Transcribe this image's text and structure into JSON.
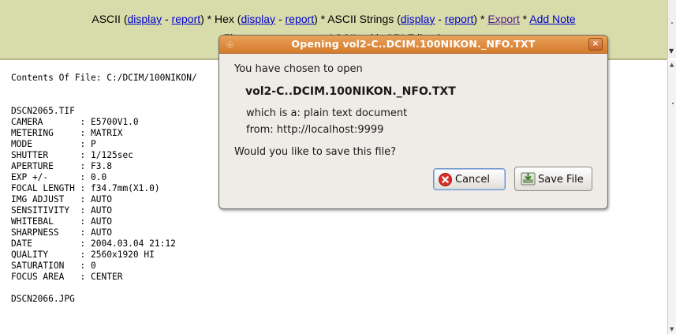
{
  "toolbar": {
    "line1": {
      "ascii_label": "ASCII (",
      "display1": "display",
      "sep1": " - ",
      "report1": "report",
      "hex_label": ") * Hex (",
      "display2": "display",
      "sep2": " - ",
      "report2": "report",
      "strings_label": ") * ASCII Strings (",
      "display3": "display",
      "sep3": " - ",
      "report3": "report",
      "after_strings": ") * ",
      "export": "Export",
      "star": " * ",
      "add_note": "Add Note"
    },
    "line2_visible_left": "Fi",
    "line2_visible_mid": "ASCII",
    "line2_visible_right": "with CRLF line b"
  },
  "content": {
    "lines": [
      "Contents Of File: C:/DCIM/100NIKON/",
      "",
      "",
      "DSCN2065.TIF",
      "CAMERA       : E5700V1.0",
      "METERING     : MATRIX",
      "MODE         : P",
      "SHUTTER      : 1/125sec",
      "APERTURE     : F3.8",
      "EXP +/-      : 0.0",
      "FOCAL LENGTH : f34.7mm(X1.0)",
      "IMG ADJUST   : AUTO",
      "SENSITIVITY  : AUTO",
      "WHITEBAL     : AUTO",
      "SHARPNESS    : AUTO",
      "DATE         : 2004.03.04 21:12",
      "QUALITY      : 2560x1920 HI",
      "SATURATION   : 0",
      "FOCUS AREA   : CENTER",
      "",
      "DSCN2066.JPG"
    ]
  },
  "dialog": {
    "title": "Opening vol2-C..DCIM.100NIKON._NFO.TXT",
    "close_glyph": "×",
    "intro": "You have chosen to open",
    "filename": "vol2-C..DCIM.100NIKON._NFO.TXT",
    "which_is_label": "which is a:",
    "which_is_value": "plain text document",
    "from_label": "from:",
    "from_value": "http://localhost:9999",
    "question": "Would you like to save this file?",
    "cancel_label": "Cancel",
    "save_label": "Save File"
  }
}
